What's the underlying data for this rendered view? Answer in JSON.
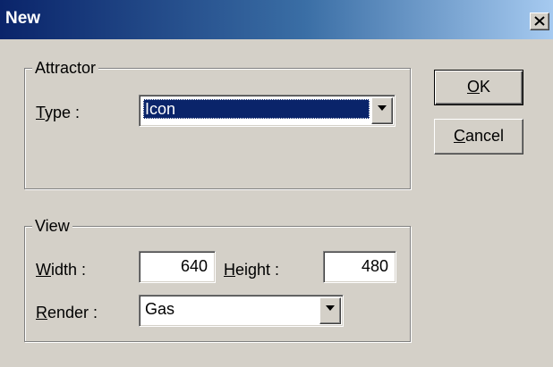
{
  "window": {
    "title": "New"
  },
  "attractor": {
    "legend": "Attractor",
    "type_label_prefix": "",
    "type_label_accel": "T",
    "type_label_rest": "ype :",
    "type_value": "Icon"
  },
  "view": {
    "legend": "View",
    "width_label_accel": "W",
    "width_label_rest": "idth :",
    "width_value": "640",
    "height_label_accel": "H",
    "height_label_rest": "eight :",
    "height_value": "480",
    "render_label_accel": "R",
    "render_label_rest": "ender :",
    "render_value": "Gas"
  },
  "buttons": {
    "ok_accel": "O",
    "ok_rest": "K",
    "cancel_accel": "C",
    "cancel_rest": "ancel"
  },
  "icons": {
    "close": "close-icon",
    "dropdown": "chevron-down-icon"
  }
}
